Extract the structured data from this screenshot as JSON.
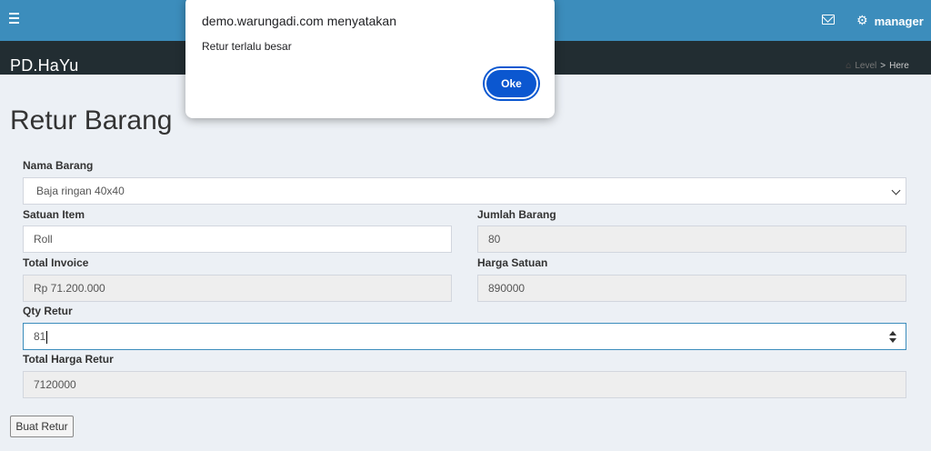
{
  "header": {
    "menu_icon": "hamburger-icon",
    "mail_icon": "mail-icon",
    "user_icon": "gear-icon",
    "user_name": "manager",
    "colors": {
      "topbar": "#3c8dbc",
      "brandbar": "#222d32",
      "background": "#ecf0f5"
    }
  },
  "brand": {
    "name": "PD.HaYu"
  },
  "breadcrumb": {
    "home_icon": "home-icon",
    "level": "Level",
    "separator": ">",
    "here": "Here"
  },
  "page": {
    "title": "Retur Barang"
  },
  "form": {
    "nama_barang": {
      "label": "Nama Barang",
      "value": "Baja ringan 40x40"
    },
    "satuan_item": {
      "label": "Satuan Item",
      "value": "Roll"
    },
    "jumlah_barang": {
      "label": "Jumlah Barang",
      "value": "80"
    },
    "total_invoice": {
      "label": "Total Invoice",
      "value": "Rp 71.200.000"
    },
    "harga_satuan": {
      "label": "Harga Satuan",
      "value": "890000"
    },
    "qty_retur": {
      "label": "Qty Retur",
      "value": "81"
    },
    "total_harga_retur": {
      "label": "Total Harga Retur",
      "value": "7120000"
    },
    "submit_label": "Buat Retur"
  },
  "dialog": {
    "title": "demo.warungadi.com menyatakan",
    "message": "Retur terlalu besar",
    "ok_label": "Oke",
    "ok_color": "#0b57d0"
  }
}
